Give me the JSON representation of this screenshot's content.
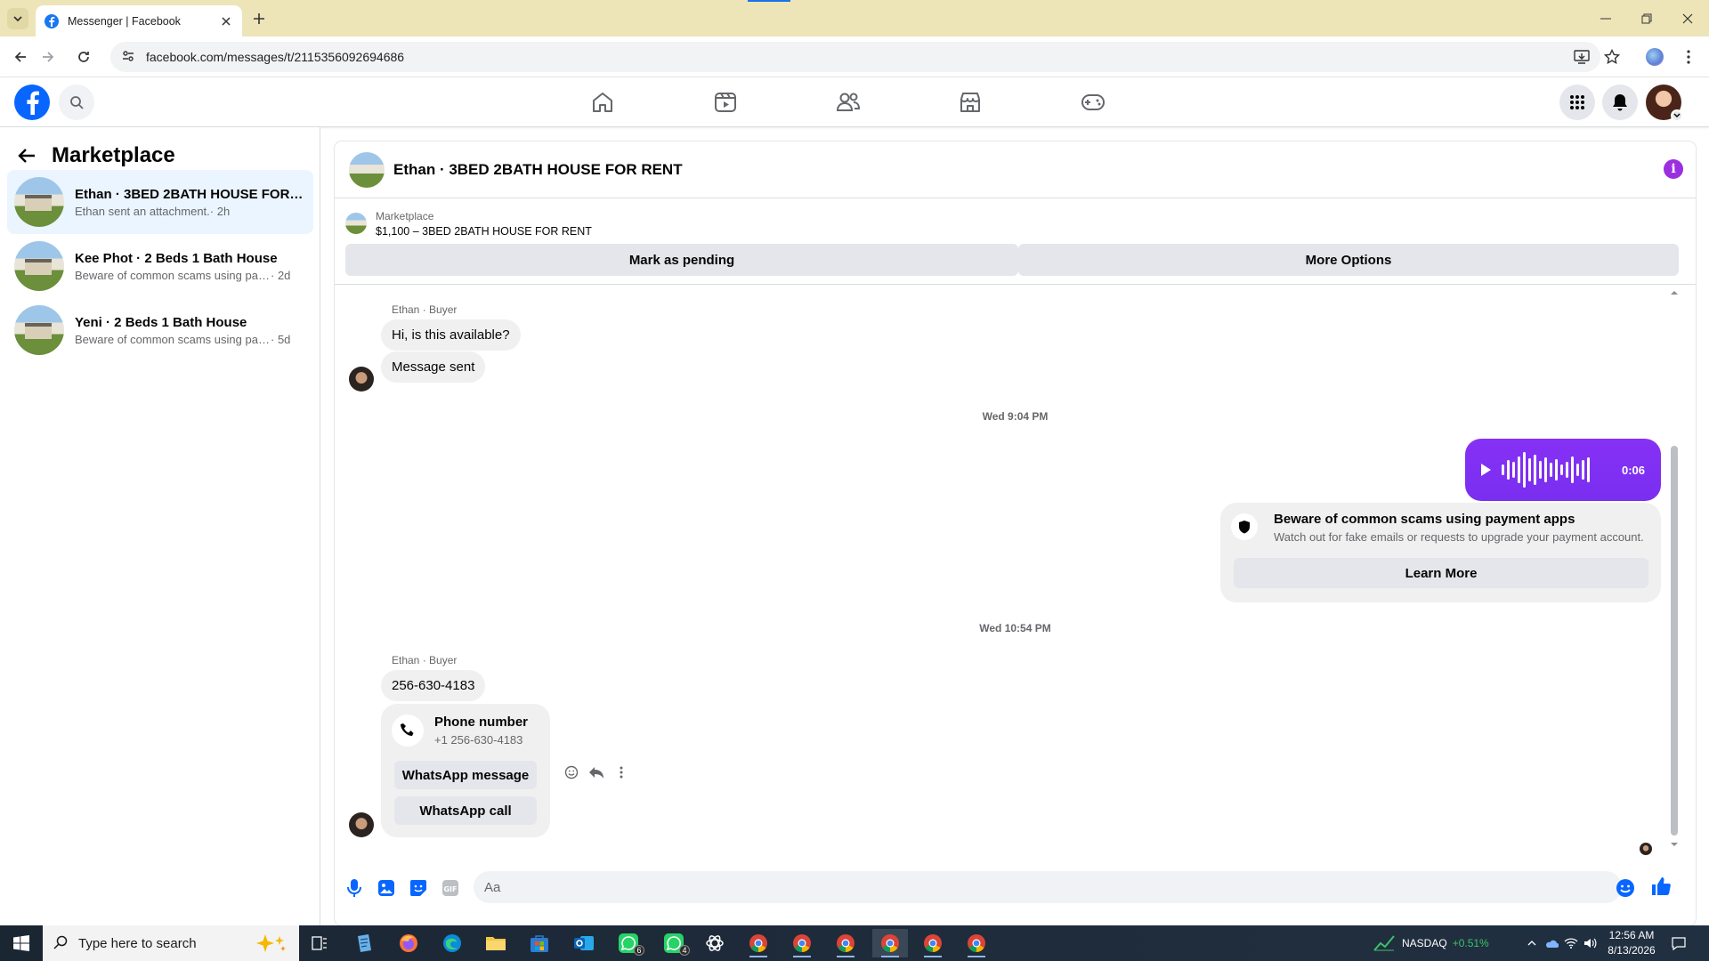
{
  "browser": {
    "tab_title": "Messenger | Facebook",
    "url": "facebook.com/messages/t/2115356092694686"
  },
  "left_panel": {
    "title": "Marketplace",
    "conversations": [
      {
        "name": "Ethan · 3BED 2BATH HOUSE FOR R...",
        "snippet": "Ethan sent an attachment.",
        "time": "· 2h"
      },
      {
        "name": "Kee Phot · 2 Beds 1 Bath House",
        "snippet": "Beware of common scams using pay...",
        "time": "· 2d"
      },
      {
        "name": "Yeni · 2 Beds 1 Bath House",
        "snippet": "Beware of common scams using pay...",
        "time": "· 5d"
      }
    ]
  },
  "chat": {
    "header_name": "Ethan · 3BED 2BATH HOUSE FOR RENT",
    "listing_category": "Marketplace",
    "listing_title": "$1,100 – 3BED 2BATH HOUSE FOR RENT",
    "mark_pending_label": "Mark as pending",
    "more_options_label": "More Options",
    "sender_label_1": "Ethan · Buyer",
    "msg_1": "Hi, is this available?",
    "msg_2": "Message sent",
    "timestamp_1": "Wed 9:04 PM",
    "voice_duration": "0:06",
    "scam_title": "Beware of common scams using payment apps",
    "scam_body": "Watch out for fake emails or requests to upgrade your payment account.",
    "learn_more_label": "Learn More",
    "timestamp_2": "Wed 10:54 PM",
    "sender_label_2": "Ethan · Buyer",
    "msg_3": "256-630-4183",
    "phone_title": "Phone number",
    "phone_number": "+1 256-630-4183",
    "whatsapp_message_label": "WhatsApp message",
    "whatsapp_call_label": "WhatsApp call",
    "composer_placeholder": "Aa"
  },
  "taskbar": {
    "search_placeholder": "Type here to search",
    "ticker_name": "NASDAQ",
    "ticker_change": "+0.51%",
    "time": "12:56 AM",
    "date": "8/13/2026",
    "whatsapp_badge_1": "6",
    "whatsapp_badge_2": "4"
  },
  "colors": {
    "facebook_blue": "#0866ff",
    "messenger_purple": "#8631f5",
    "active_conv_bg": "#ebf5ff",
    "tabbar_bg": "#ede4b8"
  }
}
